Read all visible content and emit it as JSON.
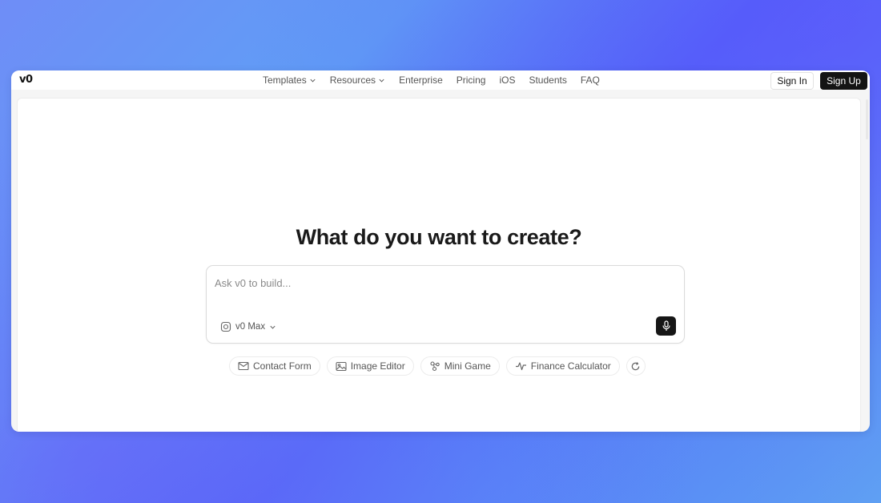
{
  "brand": {
    "logo_text": "v0"
  },
  "nav": {
    "links": [
      {
        "label": "Templates",
        "has_dropdown": true
      },
      {
        "label": "Resources",
        "has_dropdown": true
      },
      {
        "label": "Enterprise",
        "has_dropdown": false
      },
      {
        "label": "Pricing",
        "has_dropdown": false
      },
      {
        "label": "iOS",
        "has_dropdown": false
      },
      {
        "label": "Students",
        "has_dropdown": false
      },
      {
        "label": "FAQ",
        "has_dropdown": false
      }
    ],
    "sign_in": "Sign In",
    "sign_up": "Sign Up"
  },
  "hero": {
    "heading": "What do you want to create?"
  },
  "prompt": {
    "placeholder": "Ask v0 to build...",
    "value": "",
    "model_label": "v0 Max",
    "model_icon": "model-icon",
    "mic_icon": "microphone-icon"
  },
  "suggestions": [
    {
      "label": "Contact Form",
      "icon": "mail-icon"
    },
    {
      "label": "Image Editor",
      "icon": "image-icon"
    },
    {
      "label": "Mini Game",
      "icon": "game-icon"
    },
    {
      "label": "Finance Calculator",
      "icon": "activity-icon"
    }
  ],
  "colors": {
    "accent_dark": "#141414",
    "background_gradient": [
      "#6f8df7",
      "#4f66f6",
      "#5fa0f3"
    ]
  }
}
